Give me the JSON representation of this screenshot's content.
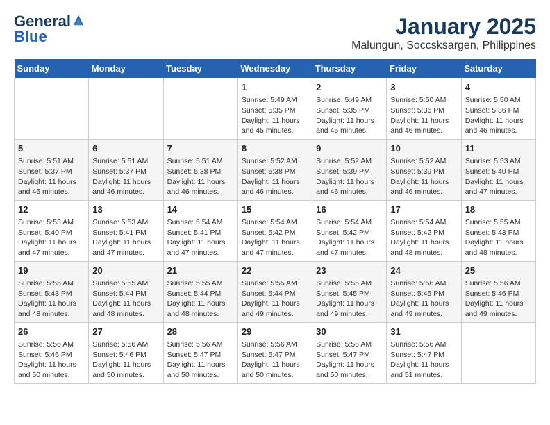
{
  "logo": {
    "line1": "General",
    "line2": "Blue"
  },
  "title": "January 2025",
  "subtitle": "Malungun, Soccsksargen, Philippines",
  "days_of_week": [
    "Sunday",
    "Monday",
    "Tuesday",
    "Wednesday",
    "Thursday",
    "Friday",
    "Saturday"
  ],
  "weeks": [
    [
      {
        "day": "",
        "content": ""
      },
      {
        "day": "",
        "content": ""
      },
      {
        "day": "",
        "content": ""
      },
      {
        "day": "1",
        "content": "Sunrise: 5:49 AM\nSunset: 5:35 PM\nDaylight: 11 hours\nand 45 minutes."
      },
      {
        "day": "2",
        "content": "Sunrise: 5:49 AM\nSunset: 5:35 PM\nDaylight: 11 hours\nand 45 minutes."
      },
      {
        "day": "3",
        "content": "Sunrise: 5:50 AM\nSunset: 5:36 PM\nDaylight: 11 hours\nand 46 minutes."
      },
      {
        "day": "4",
        "content": "Sunrise: 5:50 AM\nSunset: 5:36 PM\nDaylight: 11 hours\nand 46 minutes."
      }
    ],
    [
      {
        "day": "5",
        "content": "Sunrise: 5:51 AM\nSunset: 5:37 PM\nDaylight: 11 hours\nand 46 minutes."
      },
      {
        "day": "6",
        "content": "Sunrise: 5:51 AM\nSunset: 5:37 PM\nDaylight: 11 hours\nand 46 minutes."
      },
      {
        "day": "7",
        "content": "Sunrise: 5:51 AM\nSunset: 5:38 PM\nDaylight: 11 hours\nand 46 minutes."
      },
      {
        "day": "8",
        "content": "Sunrise: 5:52 AM\nSunset: 5:38 PM\nDaylight: 11 hours\nand 46 minutes."
      },
      {
        "day": "9",
        "content": "Sunrise: 5:52 AM\nSunset: 5:39 PM\nDaylight: 11 hours\nand 46 minutes."
      },
      {
        "day": "10",
        "content": "Sunrise: 5:52 AM\nSunset: 5:39 PM\nDaylight: 11 hours\nand 46 minutes."
      },
      {
        "day": "11",
        "content": "Sunrise: 5:53 AM\nSunset: 5:40 PM\nDaylight: 11 hours\nand 47 minutes."
      }
    ],
    [
      {
        "day": "12",
        "content": "Sunrise: 5:53 AM\nSunset: 5:40 PM\nDaylight: 11 hours\nand 47 minutes."
      },
      {
        "day": "13",
        "content": "Sunrise: 5:53 AM\nSunset: 5:41 PM\nDaylight: 11 hours\nand 47 minutes."
      },
      {
        "day": "14",
        "content": "Sunrise: 5:54 AM\nSunset: 5:41 PM\nDaylight: 11 hours\nand 47 minutes."
      },
      {
        "day": "15",
        "content": "Sunrise: 5:54 AM\nSunset: 5:42 PM\nDaylight: 11 hours\nand 47 minutes."
      },
      {
        "day": "16",
        "content": "Sunrise: 5:54 AM\nSunset: 5:42 PM\nDaylight: 11 hours\nand 47 minutes."
      },
      {
        "day": "17",
        "content": "Sunrise: 5:54 AM\nSunset: 5:42 PM\nDaylight: 11 hours\nand 48 minutes."
      },
      {
        "day": "18",
        "content": "Sunrise: 5:55 AM\nSunset: 5:43 PM\nDaylight: 11 hours\nand 48 minutes."
      }
    ],
    [
      {
        "day": "19",
        "content": "Sunrise: 5:55 AM\nSunset: 5:43 PM\nDaylight: 11 hours\nand 48 minutes."
      },
      {
        "day": "20",
        "content": "Sunrise: 5:55 AM\nSunset: 5:44 PM\nDaylight: 11 hours\nand 48 minutes."
      },
      {
        "day": "21",
        "content": "Sunrise: 5:55 AM\nSunset: 5:44 PM\nDaylight: 11 hours\nand 48 minutes."
      },
      {
        "day": "22",
        "content": "Sunrise: 5:55 AM\nSunset: 5:44 PM\nDaylight: 11 hours\nand 49 minutes."
      },
      {
        "day": "23",
        "content": "Sunrise: 5:55 AM\nSunset: 5:45 PM\nDaylight: 11 hours\nand 49 minutes."
      },
      {
        "day": "24",
        "content": "Sunrise: 5:56 AM\nSunset: 5:45 PM\nDaylight: 11 hours\nand 49 minutes."
      },
      {
        "day": "25",
        "content": "Sunrise: 5:56 AM\nSunset: 5:46 PM\nDaylight: 11 hours\nand 49 minutes."
      }
    ],
    [
      {
        "day": "26",
        "content": "Sunrise: 5:56 AM\nSunset: 5:46 PM\nDaylight: 11 hours\nand 50 minutes."
      },
      {
        "day": "27",
        "content": "Sunrise: 5:56 AM\nSunset: 5:46 PM\nDaylight: 11 hours\nand 50 minutes."
      },
      {
        "day": "28",
        "content": "Sunrise: 5:56 AM\nSunset: 5:47 PM\nDaylight: 11 hours\nand 50 minutes."
      },
      {
        "day": "29",
        "content": "Sunrise: 5:56 AM\nSunset: 5:47 PM\nDaylight: 11 hours\nand 50 minutes."
      },
      {
        "day": "30",
        "content": "Sunrise: 5:56 AM\nSunset: 5:47 PM\nDaylight: 11 hours\nand 50 minutes."
      },
      {
        "day": "31",
        "content": "Sunrise: 5:56 AM\nSunset: 5:47 PM\nDaylight: 11 hours\nand 51 minutes."
      },
      {
        "day": "",
        "content": ""
      }
    ]
  ]
}
